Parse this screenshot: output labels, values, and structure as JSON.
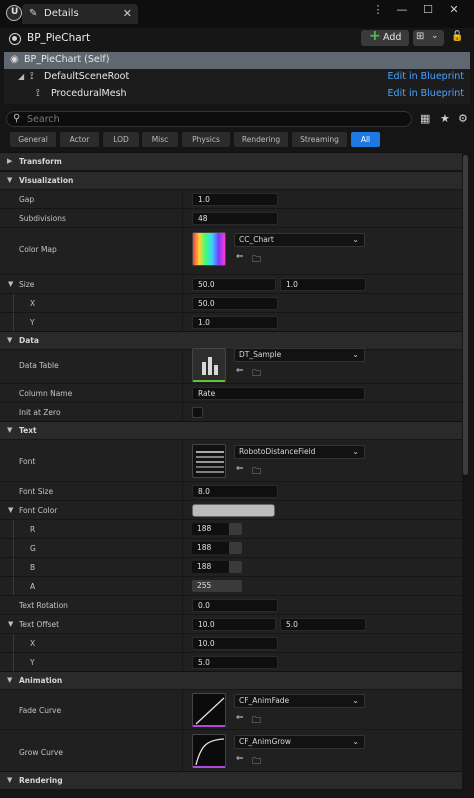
{
  "window": {
    "tab_label": "Details",
    "tab_icon": "pencil-icon",
    "minimize": "—",
    "maximize": "☐",
    "close": "✕",
    "tab_close": "✕",
    "more": "⋮"
  },
  "header": {
    "actor_name": "BP_PieChart",
    "add_label": "Add",
    "add_symbol": "+",
    "lock_symbol": "🔓"
  },
  "tree": {
    "items": [
      {
        "label": "BP_PieChart (Self)",
        "link": ""
      },
      {
        "label": "DefaultSceneRoot",
        "link": "Edit in Blueprint"
      },
      {
        "label": "ProceduralMesh",
        "link": "Edit in Blueprint"
      }
    ]
  },
  "search": {
    "placeholder": "Search",
    "icon": "search-icon"
  },
  "filters": [
    "General",
    "Actor",
    "LOD",
    "Misc",
    "Physics",
    "Rendering",
    "Streaming",
    "All"
  ],
  "categories": {
    "transform": "Transform",
    "visualization": "Visualization",
    "data": "Data",
    "text": "Text",
    "animation": "Animation",
    "rendering": "Rendering"
  },
  "props": {
    "gap": {
      "label": "Gap",
      "value": "1.0"
    },
    "subdivisions": {
      "label": "Subdivisions",
      "value": "48"
    },
    "color_map": {
      "label": "Color Map",
      "value": "CC_Chart"
    },
    "size": {
      "label": "Size",
      "x_value": "50.0",
      "y_value": "1.0"
    },
    "size_x": {
      "label": "X",
      "value": "50.0"
    },
    "size_y": {
      "label": "Y",
      "value": "1.0"
    },
    "data_table": {
      "label": "Data Table",
      "value": "DT_Sample"
    },
    "column_name": {
      "label": "Column Name",
      "value": "Rate"
    },
    "init_at_zero": {
      "label": "Init at Zero"
    },
    "font": {
      "label": "Font",
      "value": "RobotoDistanceField"
    },
    "font_size": {
      "label": "Font Size",
      "value": "8.0"
    },
    "font_color": {
      "label": "Font Color"
    },
    "r": {
      "label": "R",
      "value": "188"
    },
    "g": {
      "label": "G",
      "value": "188"
    },
    "b": {
      "label": "B",
      "value": "188"
    },
    "a": {
      "label": "A",
      "value": "255"
    },
    "text_rotation": {
      "label": "Text Rotation",
      "value": "0.0"
    },
    "text_offset": {
      "label": "Text Offset",
      "x_value": "10.0",
      "y_value": "5.0"
    },
    "offset_x": {
      "label": "X",
      "value": "10.0"
    },
    "offset_y": {
      "label": "Y",
      "value": "5.0"
    },
    "fade_curve": {
      "label": "Fade Curve",
      "value": "CF_AnimFade"
    },
    "grow_curve": {
      "label": "Grow Curve",
      "value": "CF_AnimGrow"
    }
  },
  "colors": {
    "accent": "#1c79e2",
    "link": "#4aa3ff",
    "add_green": "#4fc34f",
    "font_color_swatch": "#bcbcbc"
  }
}
